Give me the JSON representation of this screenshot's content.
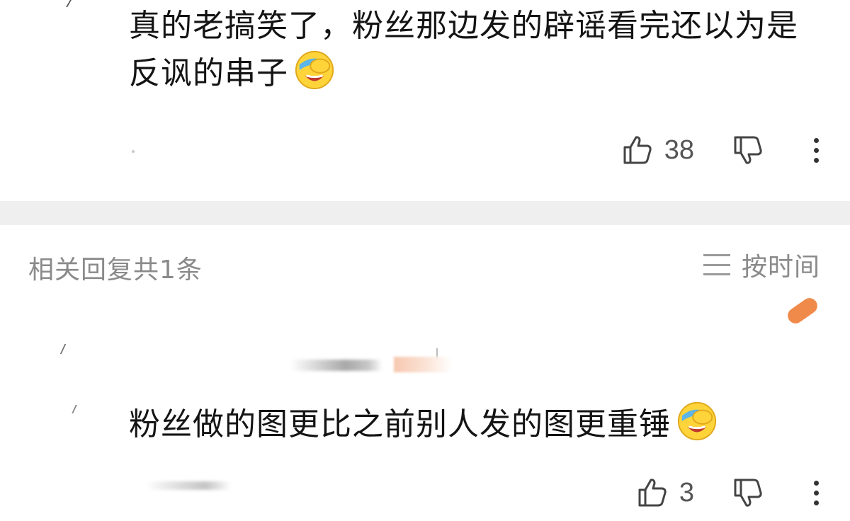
{
  "main_comment": {
    "text": "真的老搞笑了，粉丝那边发的辟谣看完还以为是反讽的串子",
    "emoji": "facepalm-laugh-emoji",
    "like_count": "38"
  },
  "replies_header": {
    "count_label": "相关回复共1条",
    "sort_label": "按时间"
  },
  "reply": {
    "text": "粉丝做的图更比之前别人发的图更重锤",
    "emoji": "facepalm-laugh-emoji",
    "like_count": "3"
  },
  "colors": {
    "text_primary": "#141414",
    "text_secondary": "#8a8a8a",
    "divider": "#efefef",
    "accent_pen": "#f08a4b",
    "emoji_yellow": "#ffd43b",
    "emoji_band": "#5bb5e8"
  }
}
